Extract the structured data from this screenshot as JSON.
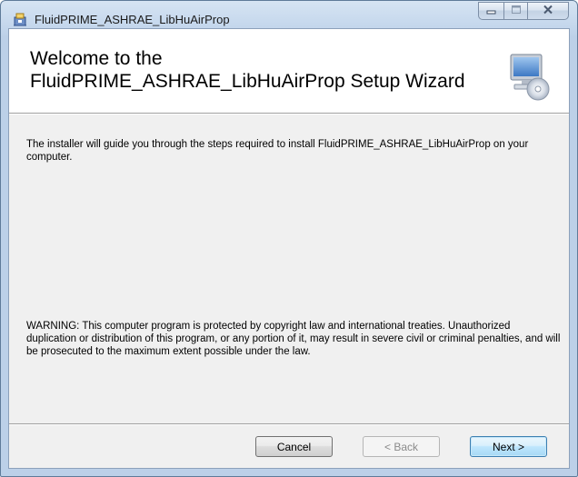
{
  "window": {
    "title": "FluidPRIME_ASHRAE_LibHuAirProp",
    "icon": "installer-package-icon"
  },
  "caption_buttons": {
    "minimize": "minimize-icon",
    "maximize": "maximize-icon",
    "close": "close-icon"
  },
  "banner": {
    "title_line1": "Welcome to the",
    "title_line2": "FluidPRIME_ASHRAE_LibHuAirProp Setup Wizard",
    "image": "computer-cd-icon"
  },
  "content": {
    "intro": "The installer will guide you through the steps required to install FluidPRIME_ASHRAE_LibHuAirProp on your computer.",
    "warning": "WARNING: This computer program is protected by copyright law and international treaties. Unauthorized duplication or distribution of this program, or any portion of it, may result in severe civil or criminal penalties, and will be prosecuted to the maximum extent possible under the law."
  },
  "buttons": {
    "cancel": "Cancel",
    "back": "< Back",
    "next": "Next >"
  },
  "colors": {
    "accent": "#3c7fb1",
    "panel": "#f0f0f0",
    "disabled_text": "#8a8a8a"
  }
}
